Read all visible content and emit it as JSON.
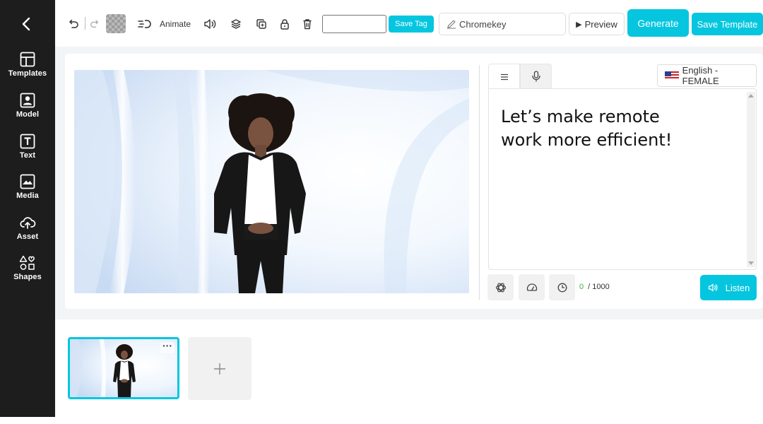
{
  "sidebar": {
    "items": [
      {
        "label": "Templates",
        "icon": "templates-icon"
      },
      {
        "label": "Model",
        "icon": "model-icon"
      },
      {
        "label": "Text",
        "icon": "text-icon"
      },
      {
        "label": "Media",
        "icon": "media-icon"
      },
      {
        "label": "Asset",
        "icon": "upload-cloud-icon"
      },
      {
        "label": "Shapes",
        "icon": "shapes-icon"
      }
    ]
  },
  "toolbar": {
    "animate_label": "Animate",
    "tag_input_value": "",
    "save_tag_label": "Save Tag",
    "chromekey_label": "Chromekey",
    "preview_label": "Preview",
    "generate_label": "Generate",
    "save_template_label": "Save Template"
  },
  "script": {
    "language_label": "English - FEMALE",
    "text_line1": "Let’s make remote",
    "text_line2": "work more efficient!",
    "char_count": "0",
    "char_limit": "/ 1000",
    "listen_label": "Listen"
  },
  "scenes": {
    "thumb_menu": "···",
    "add_symbol": "+"
  },
  "colors": {
    "accent": "#06c6df",
    "sidebar_bg": "#1d1d1d",
    "counter_green": "#3db13d"
  }
}
